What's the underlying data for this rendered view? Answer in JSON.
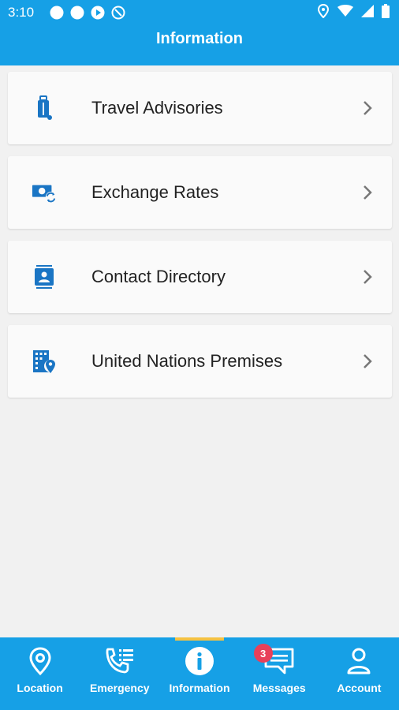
{
  "status_bar": {
    "time": "3:10",
    "left_icons": [
      "circle-notification-icon",
      "circle-notification-icon",
      "play-store-icon",
      "do-not-disturb-icon"
    ],
    "right_icons": [
      "location-icon",
      "wifi-icon",
      "signal-icon",
      "battery-icon"
    ]
  },
  "header": {
    "title": "Information"
  },
  "menu": {
    "items": [
      {
        "label": "Travel Advisories",
        "icon": "luggage-icon"
      },
      {
        "label": "Exchange Rates",
        "icon": "money-exchange-icon"
      },
      {
        "label": "Contact Directory",
        "icon": "contact-card-icon"
      },
      {
        "label": "United Nations Premises",
        "icon": "building-location-icon"
      }
    ]
  },
  "bottom_nav": {
    "items": [
      {
        "label": "Location",
        "icon": "map-pin-icon"
      },
      {
        "label": "Emergency",
        "icon": "phone-list-icon"
      },
      {
        "label": "Information",
        "icon": "info-icon",
        "active": true
      },
      {
        "label": "Messages",
        "icon": "chat-icon",
        "badge": "3"
      },
      {
        "label": "Account",
        "icon": "person-icon"
      }
    ]
  },
  "colors": {
    "primary": "#16a0e6",
    "icon_blue": "#1a75c4",
    "active_indicator": "#f5c242",
    "badge": "#e8405a",
    "background": "#f1f1f1",
    "card": "#fafafa"
  }
}
